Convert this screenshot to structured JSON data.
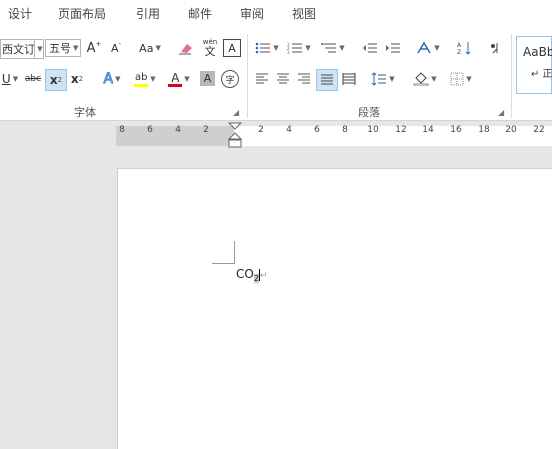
{
  "menu": {
    "tabs": [
      "设计",
      "页面布局",
      "引用",
      "邮件",
      "审阅",
      "视图"
    ]
  },
  "font": {
    "name_value": "西文订",
    "size_value": "五号",
    "grow_label": "A",
    "shrink_label": "A",
    "case_label": "Aa",
    "phonetic_label": "wén",
    "border_char_label": "A",
    "underline_label": "U",
    "strike_label": "abc",
    "subscript_label": "x",
    "subscript_sub": "2",
    "superscript_label": "x",
    "superscript_sup": "2",
    "effects_label": "A",
    "highlight_label": "ab",
    "fontcolor_label": "A",
    "shading_label": "A",
    "enclose_label": "字",
    "group_label": "字体"
  },
  "paragraph": {
    "group_label": "段落"
  },
  "styles": {
    "preview_text": "AaBbC",
    "preview_sub": "↵ 正"
  },
  "ruler": {
    "ticks": [
      "8",
      "6",
      "4",
      "2",
      "2",
      "4",
      "6",
      "8",
      "10",
      "12",
      "14",
      "16",
      "18",
      "20",
      "22"
    ]
  },
  "document": {
    "text_main": "CO",
    "text_sub": "2",
    "paragraph_mark": "↵"
  },
  "colors": {
    "highlight": "#ffff00",
    "font_color": "#e0001b",
    "selected_bg": "#cfe3f5"
  }
}
